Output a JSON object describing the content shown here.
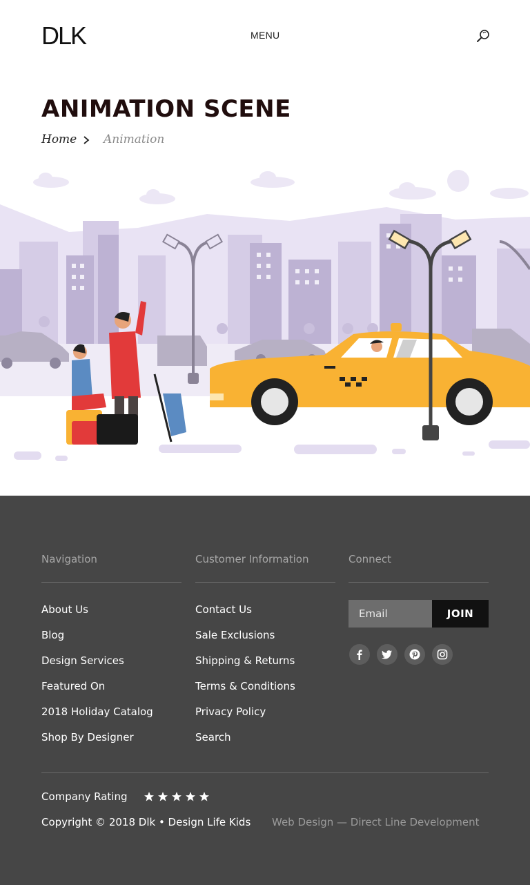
{
  "header": {
    "logo": "DLK",
    "menu_label": "MENU"
  },
  "page": {
    "title": "ANIMATION SCENE",
    "breadcrumb": {
      "home": "Home",
      "current": "Animation"
    }
  },
  "footer": {
    "navigation": {
      "heading": "Navigation",
      "items": [
        "About Us",
        "Blog",
        "Design Services",
        "Featured On",
        "2018 Holiday Catalog",
        "Shop By Designer"
      ]
    },
    "customer_info": {
      "heading": "Customer Information",
      "items": [
        "Contact Us",
        "Sale Exclusions",
        "Shipping & Returns",
        "Terms & Conditions",
        "Privacy Policy",
        "Search"
      ]
    },
    "connect": {
      "heading": "Connect",
      "email_placeholder": "Email",
      "join_label": "JOIN",
      "socials": [
        "facebook-icon",
        "twitter-icon",
        "pinterest-icon",
        "instagram-icon"
      ]
    },
    "rating": {
      "label": "Company Rating",
      "stars": 5,
      "max": 5
    },
    "copyright": "Copyright © 2018 Dlk • Design Life Kids",
    "credit": "Web Design — Direct Line Development"
  },
  "colors": {
    "footer_bg": "#464646",
    "title": "#200d0d",
    "taxi": "#f9b233",
    "scene_lilac": "#e6e0f2"
  }
}
